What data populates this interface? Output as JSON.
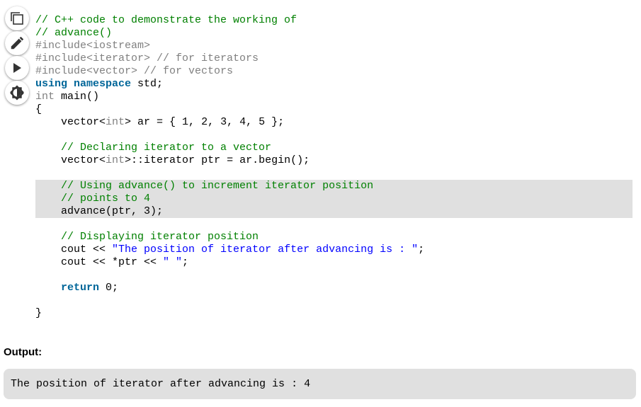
{
  "toolbar": {
    "icons": [
      "copy-icon",
      "edit-icon",
      "run-icon",
      "theme-toggle-icon"
    ]
  },
  "code": {
    "lines": [
      "// C++ code to demonstrate the working of",
      "// advance()",
      "#include<iostream>",
      "#include<iterator> // for iterators",
      "#include<vector> // for vectors",
      "using namespace std;",
      "int main()",
      "{",
      "    vector<int> ar = { 1, 2, 3, 4, 5 };",
      "",
      "    // Declaring iterator to a vector",
      "    vector<int>::iterator ptr = ar.begin();",
      "",
      "    // Using advance() to increment iterator position",
      "    // points to 4",
      "    advance(ptr, 3);",
      "",
      "    // Displaying iterator position",
      "    cout << \"The position of iterator after advancing is : \";",
      "    cout << *ptr << \" \";",
      "",
      "    return 0;",
      "",
      "}"
    ],
    "highlighted_lines": [
      13,
      14,
      15
    ]
  },
  "output": {
    "label": "Output:",
    "text": "The position of iterator after advancing is : 4"
  },
  "colors": {
    "comment": "#008000",
    "preprocessor": "#808080",
    "keyword": "#006699",
    "type": "#808080",
    "string": "#0000ff",
    "highlight_bg": "#e0e0e0",
    "output_bg": "#e0e0e0"
  }
}
